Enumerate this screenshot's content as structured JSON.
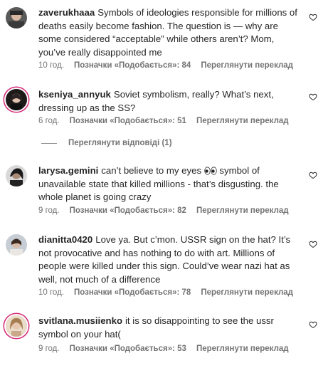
{
  "comments": [
    {
      "username": "zaverukhaaa",
      "text": "Symbols of ideologies responsible for millions of deaths easily become fashion. The question is — why are some considered “acceptable” while others aren’t? Mom, you’ve really disappointed me",
      "time": "10 год.",
      "likes": "Позначки «Подобається»: 84",
      "translate": "Переглянути переклад"
    },
    {
      "username": "kseniya_annyuk",
      "text": "Soviet symbolism, really? What’s next, dressing up as the SS?",
      "time": "6 год.",
      "likes": "Позначки «Подобається»: 51",
      "translate": "Переглянути переклад"
    },
    {
      "username": "larysa.gemini",
      "text_before": "can’t believe to my eyes",
      "text_after": "symbol of unavailable state that killed millions - that’s disgusting. the whole planet is going crazy",
      "time": "9 год.",
      "likes": "Позначки «Подобається»: 82",
      "translate": "Переглянути переклад"
    },
    {
      "username": "dianitta0420",
      "text": "Love ya. But c’mon. USSR sign on the hat? It’s not provocative and has nothing to do with art. Millions of people were killed under this sign. Could’ve wear nazi hat as well, not much of a difference",
      "time": "10 год.",
      "likes": "Позначки «Подобається»: 78",
      "translate": "Переглянути переклад"
    },
    {
      "username": "svitlana.musiienko",
      "text": "it is so disappointing to see the ussr symbol on your hat(",
      "time": "9 год.",
      "likes": "Позначки «Подобається»: 53",
      "translate": "Переглянути переклад"
    }
  ],
  "view_replies": "Переглянути відповіді (1)",
  "icons": {
    "like": "heart-outline-icon",
    "eyes": "eyes-emoji-icon"
  },
  "colors": {
    "text": "#262626",
    "muted": "#737373",
    "story_ring": "#d62976"
  }
}
